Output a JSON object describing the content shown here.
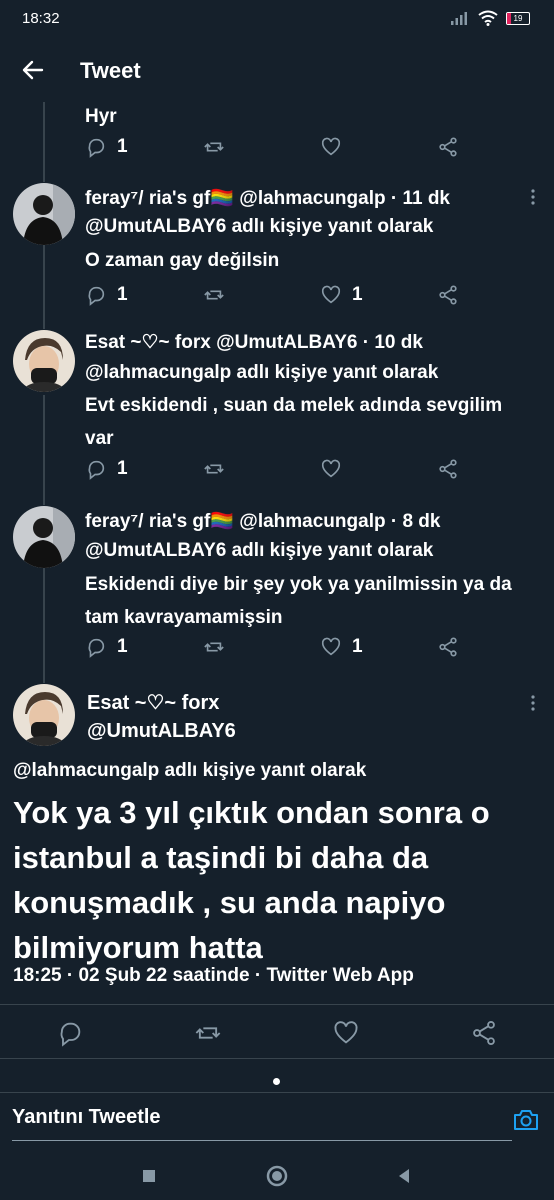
{
  "status_bar": {
    "time": "18:32",
    "battery": "19",
    "battery_color": "#e0245e"
  },
  "header": {
    "title": "Tweet"
  },
  "top_fragment": {
    "text": "Hyr",
    "replies": "1"
  },
  "tweets": [
    {
      "name": "feray⁷/ ria's gf🏳️‍🌈",
      "handle": "@lahmacungalp",
      "time": "· 11 dk",
      "reply_to": "@UmutALBAY6 adlı kişiye yanıt olarak",
      "text": "O zaman gay değilsin",
      "replies": "1",
      "likes": "1"
    },
    {
      "name": "Esat ~♡~ forx",
      "handle": "@UmutALBAY6",
      "time": "· 10 dk",
      "reply_to": "@lahmacungalp adlı kişiye yanıt olarak",
      "text": "Evt eskidendi , suan da melek adında sevgilim var",
      "replies": "1",
      "likes": ""
    },
    {
      "name": "feray⁷/ ria's gf🏳️‍🌈",
      "handle": "@lahmacungalp",
      "time": "· 8 dk",
      "reply_to": "@UmutALBAY6 adlı kişiye yanıt olarak",
      "text": "Eskidendi diye bir şey yok ya yanilmissin ya da tam kavrayamamişsin",
      "replies": "1",
      "likes": "1"
    }
  ],
  "main_tweet": {
    "name": "Esat ~♡~ forx",
    "handle": "@UmutALBAY6",
    "reply_to": "@lahmacungalp adlı kişiye yanıt olarak",
    "text": "Yok ya 3 yıl çıktık ondan sonra o istanbul a taşindi bi daha da konuşmadık , su anda napiyo bilmiyorum hatta",
    "meta": "18:25 · 02 Şub 22 saatinde · Twitter Web App"
  },
  "reply_bar": {
    "placeholder": "Yanıtını Tweetle",
    "accent": "#1da1f2"
  },
  "icons": [
    "back-arrow-icon",
    "reply-icon",
    "retweet-icon",
    "like-icon",
    "share-icon",
    "more-icon",
    "camera-icon"
  ],
  "colors": {
    "background": "#15202b",
    "icon": "#8899a6",
    "divider": "#38444d",
    "accent": "#1da1f2"
  }
}
